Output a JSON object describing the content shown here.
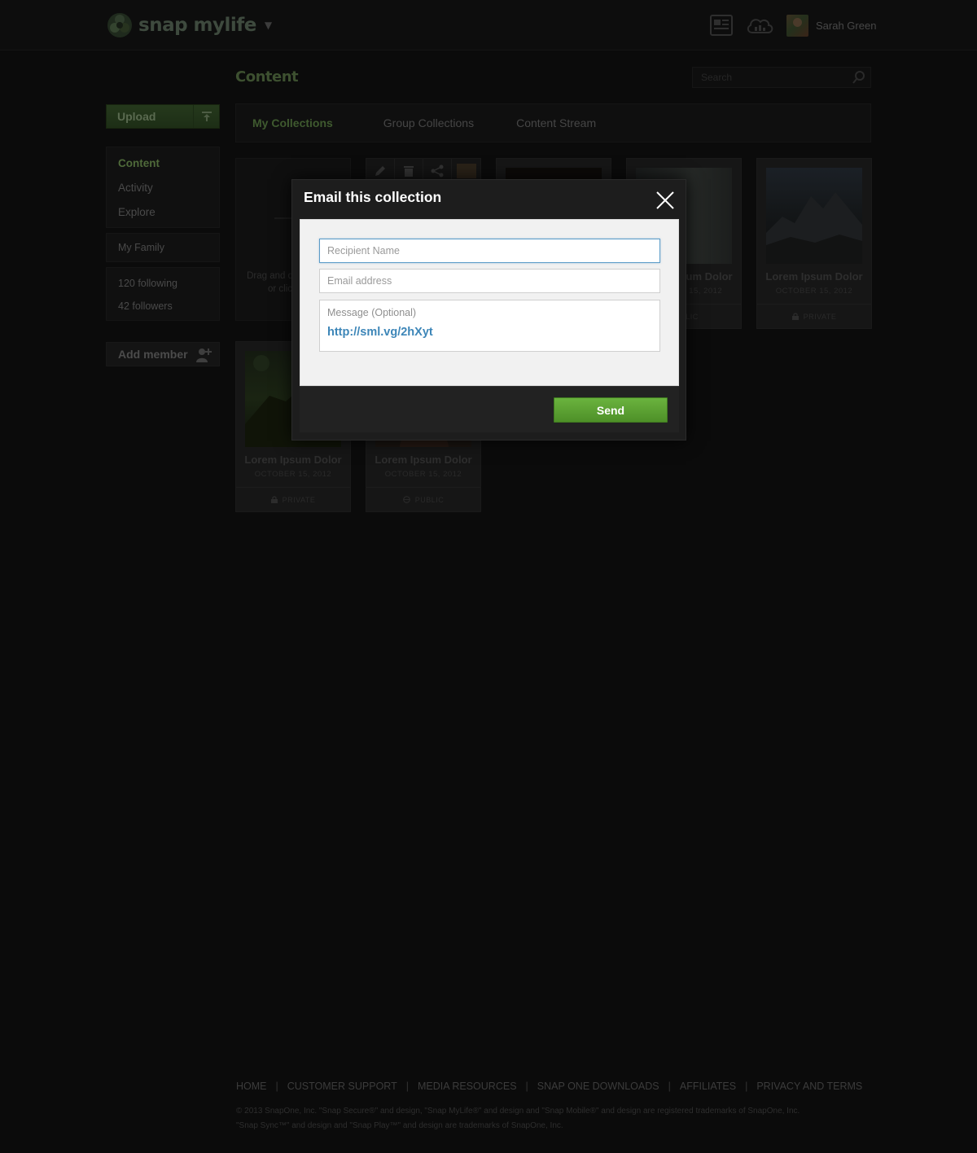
{
  "header": {
    "brand": "snap mylife",
    "user_name": "Sarah Green",
    "icons": [
      "news-icon",
      "cloud-icon"
    ]
  },
  "sidebar": {
    "upload_label": "Upload",
    "nav": [
      "Content",
      "Activity",
      "Explore"
    ],
    "family": "My Family",
    "following": "120 following",
    "followers": "42 followers",
    "add_member_label": "Add member"
  },
  "main": {
    "title": "Content",
    "search_placeholder": "Search",
    "tabs": [
      "My Collections",
      "Group Collections",
      "Content Stream"
    ],
    "dropzone_text": "Drag and drop images or click here",
    "cards": [
      {
        "title": "Lorem Ipsum Dolor",
        "date": "OCTOBER 15, 2012",
        "privacy": "PUBLIC"
      },
      {
        "title": "Lorem Ipsum Dolor",
        "date": "OCTOBER 15, 2012",
        "privacy": "PRIVATE"
      },
      {
        "title": "Lorem Ipsum Dolor",
        "date": "OCTOBER 15, 2012",
        "privacy": "PRIVATE"
      },
      {
        "title": "Lorem Ipsum Dolor",
        "date": "OCTOBER 15, 2012",
        "privacy": "PUBLIC"
      }
    ]
  },
  "modal": {
    "title": "Email this collection",
    "recipient_placeholder": "Recipient Name",
    "email_placeholder": "Email address",
    "message_label": "Message (Optional)",
    "message_link": "http://sml.vg/2hXyt",
    "send_label": "Send"
  },
  "footer": {
    "links": [
      "HOME",
      "CUSTOMER SUPPORT",
      "MEDIA RESOURCES",
      "SNAP ONE DOWNLOADS",
      "AFFILIATES",
      "PRIVACY AND TERMS"
    ],
    "copyright_1": "© 2013 SnapOne, Inc. \"Snap Secure®\" and design, \"Snap MyLife®\" and design and \"Snap Mobile®\" and design are registered trademarks of SnapOne, Inc.",
    "copyright_2": "\"Snap Sync™\" and design and \"Snap Play™\" and design are trademarks of SnapOne, Inc."
  },
  "colors": {
    "accent_green": "#6ab33e",
    "link_blue": "#3d86b8",
    "focus_blue": "#5b9bc7"
  }
}
